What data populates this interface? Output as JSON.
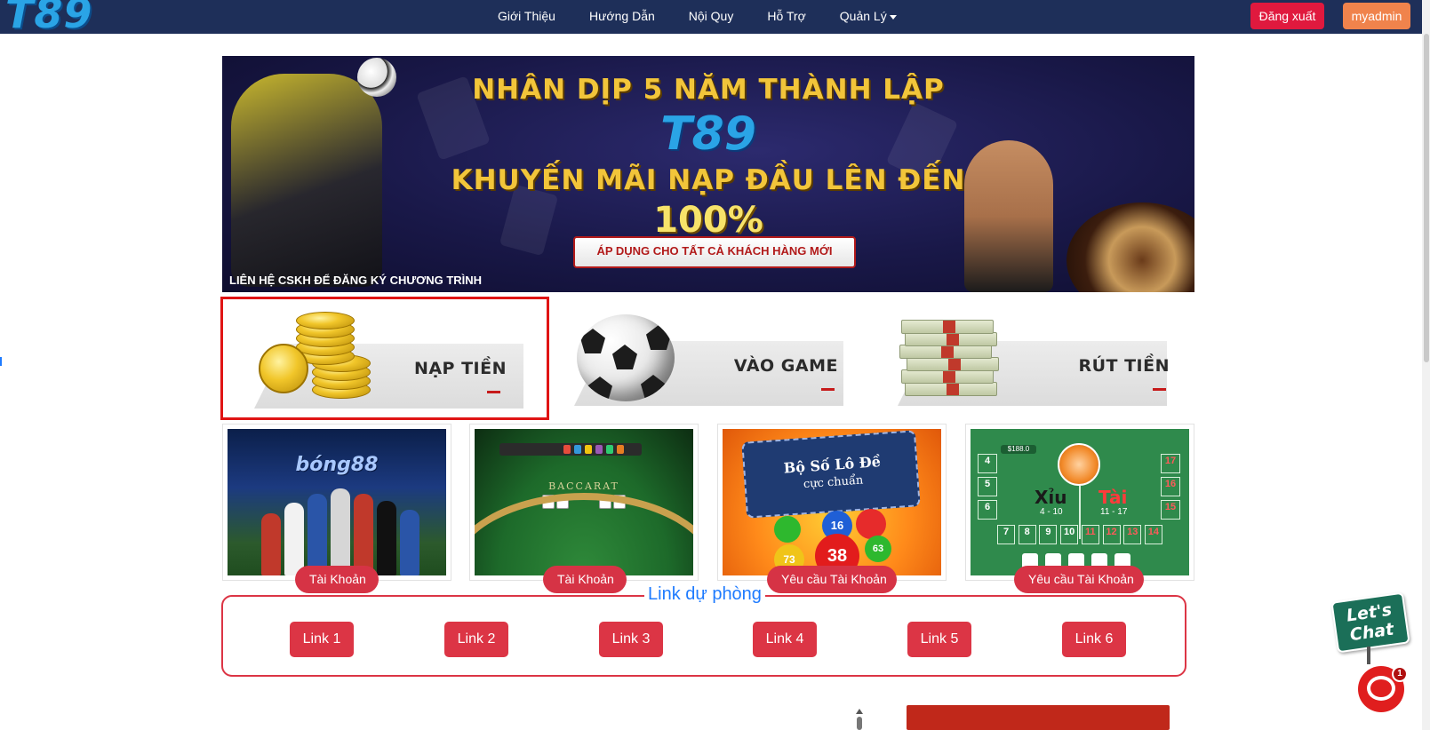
{
  "navbar": {
    "logo": "T89",
    "links": [
      "Giới Thiệu",
      "Hướng Dẫn",
      "Nội Quy",
      "Hỗ Trợ"
    ],
    "dropdown_label": "Quản Lý",
    "logout_label": "Đăng xuất",
    "user_label": "myadmin"
  },
  "banner": {
    "line1": "NHÂN DỊP 5 NĂM THÀNH LẬP",
    "brand": "T89",
    "line2": "KHUYẾN MÃI NẠP ĐẦU LÊN ĐẾN",
    "percent": "100%",
    "ribbon": "ÁP DỤNG CHO TẤT CẢ KHÁCH HÀNG MỚI",
    "footer": "LIÊN HỆ CSKH ĐỂ ĐĂNG KÝ CHƯƠNG TRÌNH"
  },
  "actions": [
    {
      "label": "NẠP TIỀN",
      "icon": "gold-coins-icon",
      "selected": true
    },
    {
      "label": "VÀO GAME",
      "icon": "soccer-ball-icon",
      "selected": false
    },
    {
      "label": "RÚT TIỀN",
      "icon": "money-stack-icon",
      "selected": false
    }
  ],
  "games": [
    {
      "title": "bóng88",
      "button": "Tài Khoản"
    },
    {
      "title": "BACCARAT",
      "button": "Tài Khoản"
    },
    {
      "title": "Bộ Số Lô Đề cực chuẩn",
      "button": "Yêu cầu Tài Khoản"
    },
    {
      "title": "Xỉu Tài",
      "button": "Yêu cầu Tài Khoản"
    }
  ],
  "game_images": {
    "lotto_line1": "Bộ Số Lô Đề",
    "lotto_line2": "cực chuẩn",
    "lotto_balls": [
      "16",
      "38",
      "73",
      "63"
    ],
    "baccarat_text": "BACCARAT",
    "xiu_label": "Xỉu",
    "xiu_range": "4 - 10",
    "tai_label": "Tài",
    "tai_range": "11 - 17",
    "xiu_bet": "$188.0",
    "xiu_left_col": [
      "4",
      "5",
      "6"
    ],
    "xiu_right_col": [
      "17",
      "16",
      "15"
    ],
    "xiu_bottom_row": [
      "7",
      "8",
      "9",
      "10",
      "11",
      "12",
      "13",
      "14"
    ]
  },
  "backup": {
    "legend": "Link dự phòng",
    "links": [
      "Link 1",
      "Link 2",
      "Link 3",
      "Link 4",
      "Link 5",
      "Link 6"
    ]
  },
  "chat": {
    "sign_line1": "Let's",
    "sign_line2": "Chat",
    "badge": "1"
  },
  "colors": {
    "navbar": "#1e2f59",
    "logout": "#e0193e",
    "user": "#f0834c",
    "primary_red": "#dc3545",
    "legend_blue": "#1e7bff"
  }
}
